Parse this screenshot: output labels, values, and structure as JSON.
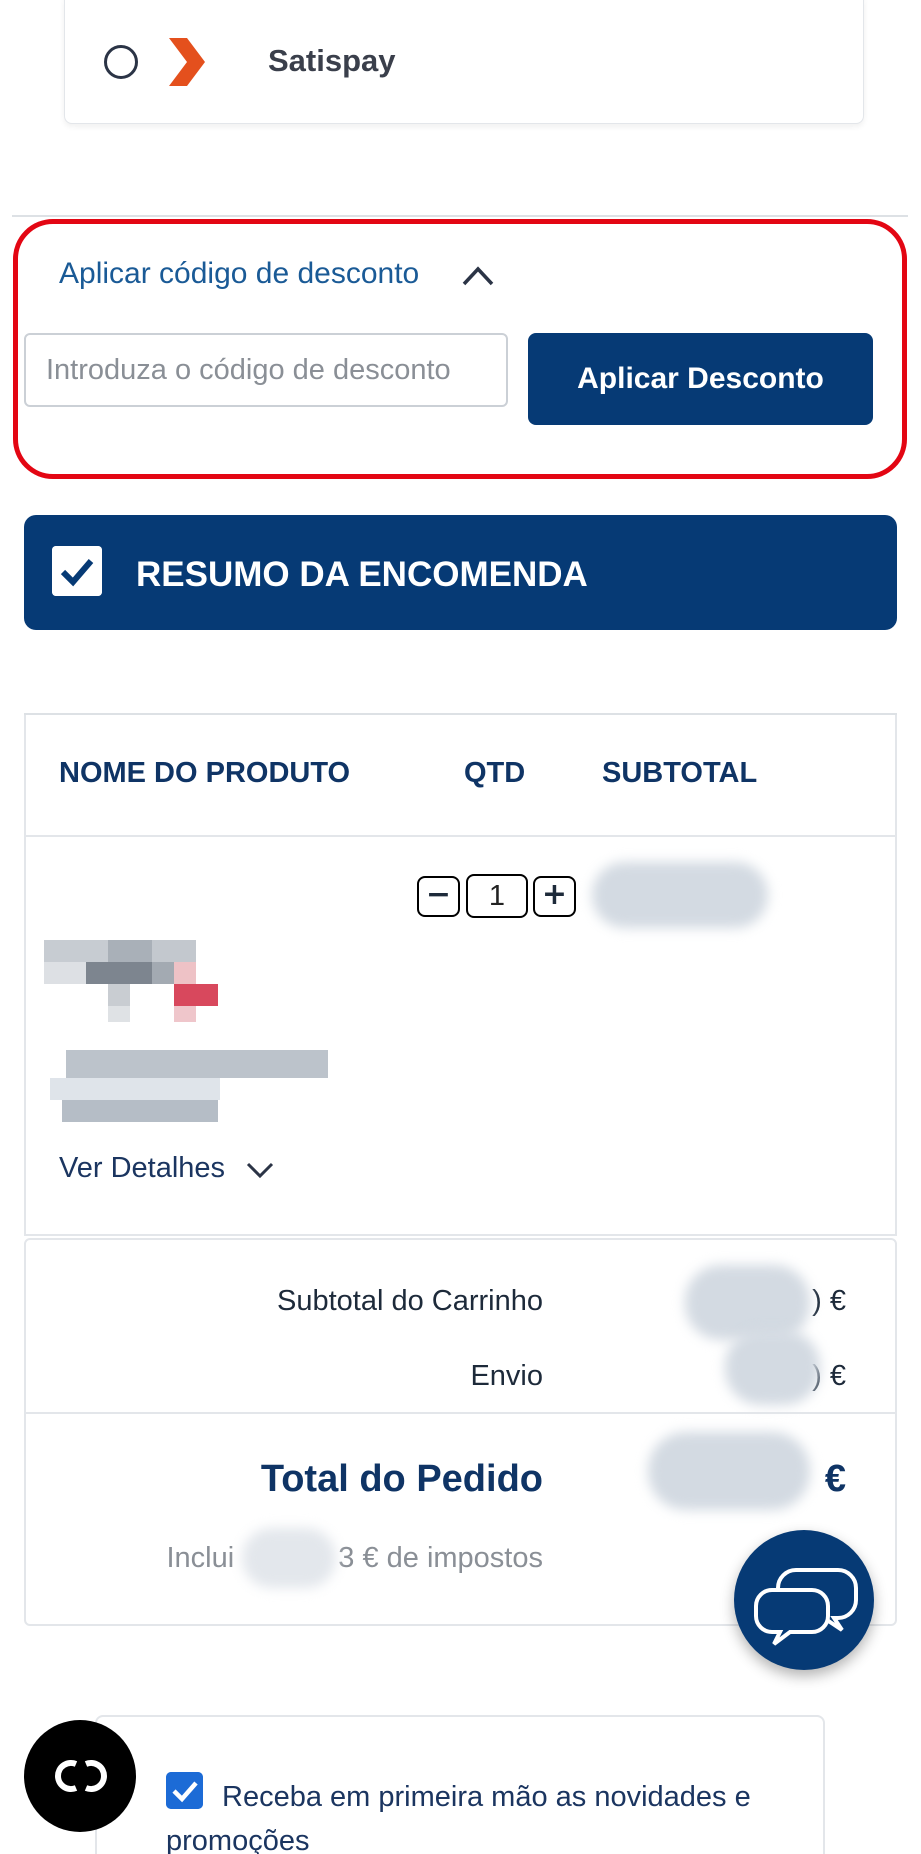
{
  "payment": {
    "option_label": "Satispay",
    "brand_color": "#e4501d"
  },
  "discount": {
    "toggle_label": "Aplicar código de desconto",
    "input_placeholder": "Introduza o código de desconto",
    "button_label": "Aplicar Desconto",
    "highlight_color": "#e30613"
  },
  "summary": {
    "title": "RESUMO DA ENCOMENDA",
    "accent": "#063a75"
  },
  "table": {
    "headers": {
      "name": "NOME DO PRODUTO",
      "qty": "QTD",
      "subtotal": "SUBTOTAL"
    },
    "item": {
      "qty_decrease": "−",
      "quantity": "1",
      "qty_increase": "+",
      "details_label": "Ver Detalhes"
    }
  },
  "totals": {
    "cart_subtotal_label": "Subtotal do Carrinho",
    "cart_subtotal_value_visible": ") €",
    "shipping_label": "Envio",
    "shipping_value_visible": ") €",
    "order_total_label": "Total do Pedido",
    "order_total_value_visible": "€",
    "tax_prefix": "Inclui",
    "tax_suffix": "3 € de impostos"
  },
  "newsletter": {
    "label": "Receba em primeira mão as novidades e promoções",
    "checked": true
  },
  "icons": {
    "radio": "radio-unchecked-icon",
    "chevron_up": "chevron-up-icon",
    "chevron_down": "chevron-down-icon",
    "check": "checkmark-icon",
    "chat": "chat-bubbles-icon",
    "cookie": "cookie-settings-icon"
  }
}
